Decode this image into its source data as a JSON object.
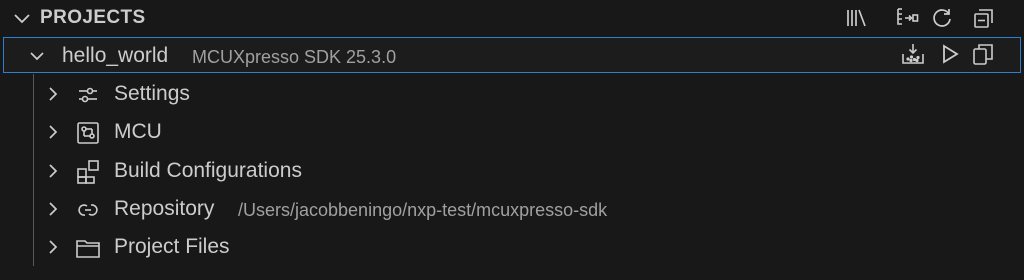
{
  "header": {
    "title": "PROJECTS",
    "actions": [
      {
        "icon": "library-icon"
      },
      {
        "icon": "import-project-icon"
      },
      {
        "icon": "refresh-icon"
      },
      {
        "icon": "collapse-all-icon"
      }
    ]
  },
  "project": {
    "name": "hello_world",
    "sdk": "MCUXpresso SDK 25.3.0",
    "actions": [
      {
        "icon": "build-icon"
      },
      {
        "icon": "run-icon"
      },
      {
        "icon": "copy-icon"
      }
    ]
  },
  "tree": {
    "items": [
      {
        "label": "Settings",
        "icon": "settings-sliders-icon",
        "description": ""
      },
      {
        "label": "MCU",
        "icon": "chip-icon",
        "description": ""
      },
      {
        "label": "Build Configurations",
        "icon": "extensions-icon",
        "description": ""
      },
      {
        "label": "Repository",
        "icon": "link-icon",
        "description": "/Users/jacobbeningo/nxp-test/mcuxpresso-sdk"
      },
      {
        "label": "Project Files",
        "icon": "folder-icon",
        "description": ""
      }
    ]
  },
  "colors": {
    "background": "#181818",
    "text": "#cccccc",
    "description": "#a0a0a0",
    "focus_border": "#2f7fcf"
  }
}
